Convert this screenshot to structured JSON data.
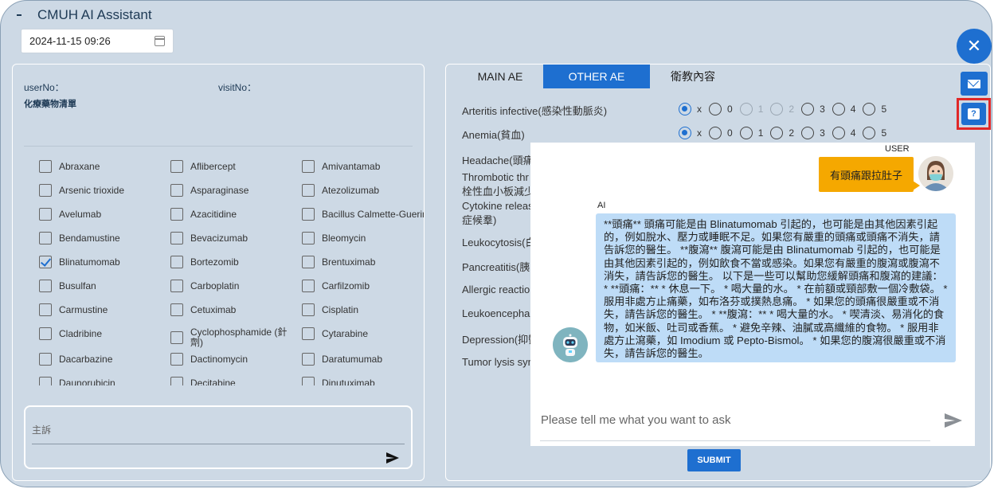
{
  "app": {
    "title": "CMUH AI Assistant"
  },
  "date": {
    "value": "2024-11-15 09:26"
  },
  "patient": {
    "user_label": "userNo：",
    "visit_label": "visitNo："
  },
  "drug_list": {
    "title": "化療藥物清單",
    "columns": [
      [
        {
          "name": "Abraxane",
          "checked": false
        },
        {
          "name": "Arsenic trioxide",
          "checked": false
        },
        {
          "name": "Avelumab",
          "checked": false
        },
        {
          "name": "Bendamustine",
          "checked": false
        },
        {
          "name": "Blinatumomab",
          "checked": true
        },
        {
          "name": "Busulfan",
          "checked": false
        },
        {
          "name": "Carmustine",
          "checked": false
        },
        {
          "name": "Cladribine",
          "checked": false
        },
        {
          "name": "Dacarbazine",
          "checked": false
        },
        {
          "name": "Daunorubicin",
          "checked": false
        }
      ],
      [
        {
          "name": "Aflibercept",
          "checked": false
        },
        {
          "name": "Asparaginase",
          "checked": false
        },
        {
          "name": "Azacitidine",
          "checked": false
        },
        {
          "name": "Bevacizumab",
          "checked": false
        },
        {
          "name": "Bortezomib",
          "checked": false
        },
        {
          "name": "Carboplatin",
          "checked": false
        },
        {
          "name": "Cetuximab",
          "checked": false
        },
        {
          "name": "Cyclophosphamide (針劑)",
          "checked": false
        },
        {
          "name": "Dactinomycin",
          "checked": false
        },
        {
          "name": "Decitabine",
          "checked": false
        }
      ],
      [
        {
          "name": "Amivantamab",
          "checked": false
        },
        {
          "name": "Atezolizumab",
          "checked": false
        },
        {
          "name": "Bacillus Calmette-Guerin",
          "checked": false
        },
        {
          "name": "Bleomycin",
          "checked": false
        },
        {
          "name": "Brentuximab",
          "checked": false
        },
        {
          "name": "Carfilzomib",
          "checked": false
        },
        {
          "name": "Cisplatin",
          "checked": false
        },
        {
          "name": "Cytarabine",
          "checked": false
        },
        {
          "name": "Daratumumab",
          "checked": false
        },
        {
          "name": "Dinutuximab",
          "checked": false
        }
      ]
    ]
  },
  "complaint": {
    "label": "主訴"
  },
  "tabs": [
    {
      "label": "MAIN AE",
      "active": false
    },
    {
      "label": "OTHER AE",
      "active": true
    },
    {
      "label": "衛教內容",
      "active": false
    }
  ],
  "grade_labels": [
    "x",
    "0",
    "1",
    "2",
    "3",
    "4",
    "5"
  ],
  "ae_items": [
    {
      "name": "Arteritis infective(感染性動脈炎)",
      "selected": "x",
      "disabled": [
        "1",
        "2"
      ]
    },
    {
      "name": "Anemia(貧血)",
      "selected": "x",
      "disabled": []
    },
    {
      "name": "Headache(頭痛"
    },
    {
      "name": "Thrombotic thr",
      "name2": "栓性血小板減少"
    },
    {
      "name": "Cytokine releas",
      "name2": "症候羣)"
    },
    {
      "name": "Leukocytosis(白"
    },
    {
      "name": "Pancreatitis(胰"
    },
    {
      "name": "Allergic reactio"
    },
    {
      "name": "Leukoencephal"
    },
    {
      "name": "Depression(抑鬱"
    },
    {
      "name": "Tumor lysis syn"
    }
  ],
  "submit_label": "SUBMIT",
  "fab": {
    "close_glyph": "✕",
    "help_glyph": "?"
  },
  "chat": {
    "user_role": "USER",
    "user_message": "有頭痛跟拉肚子",
    "ai_role": "AI",
    "ai_message": "**頭痛** 頭痛可能是由 Blinatumomab 引起的，也可能是由其他因素引起的，例如脫水、壓力或睡眠不足。如果您有嚴重的頭痛或頭痛不消失，請告訴您的醫生。 **腹瀉** 腹瀉可能是由 Blinatumomab 引起的，也可能是由其他因素引起的，例如飲食不當或感染。如果您有嚴重的腹瀉或腹瀉不消失，請告訴您的醫生。 以下是一些可以幫助您緩解頭痛和腹瀉的建議： * **頭痛：** * 休息一下。 * 喝大量的水。 * 在前額或頸部敷一個冷敷袋。 * 服用非處方止痛藥，如布洛芬或撲熱息痛。 * 如果您的頭痛很嚴重或不消失，請告訴您的醫生。 * **腹瀉：** * 喝大量的水。 * 喫清淡、易消化的食物，如米飯、吐司或香蕉。 * 避免辛辣、油膩或高纖維的食物。 * 服用非處方止瀉藥，如 Imodium 或 Pepto-Bismol。 * 如果您的腹瀉很嚴重或不消失，請告訴您的醫生。",
    "input_placeholder": "Please tell me what you want to ask"
  }
}
